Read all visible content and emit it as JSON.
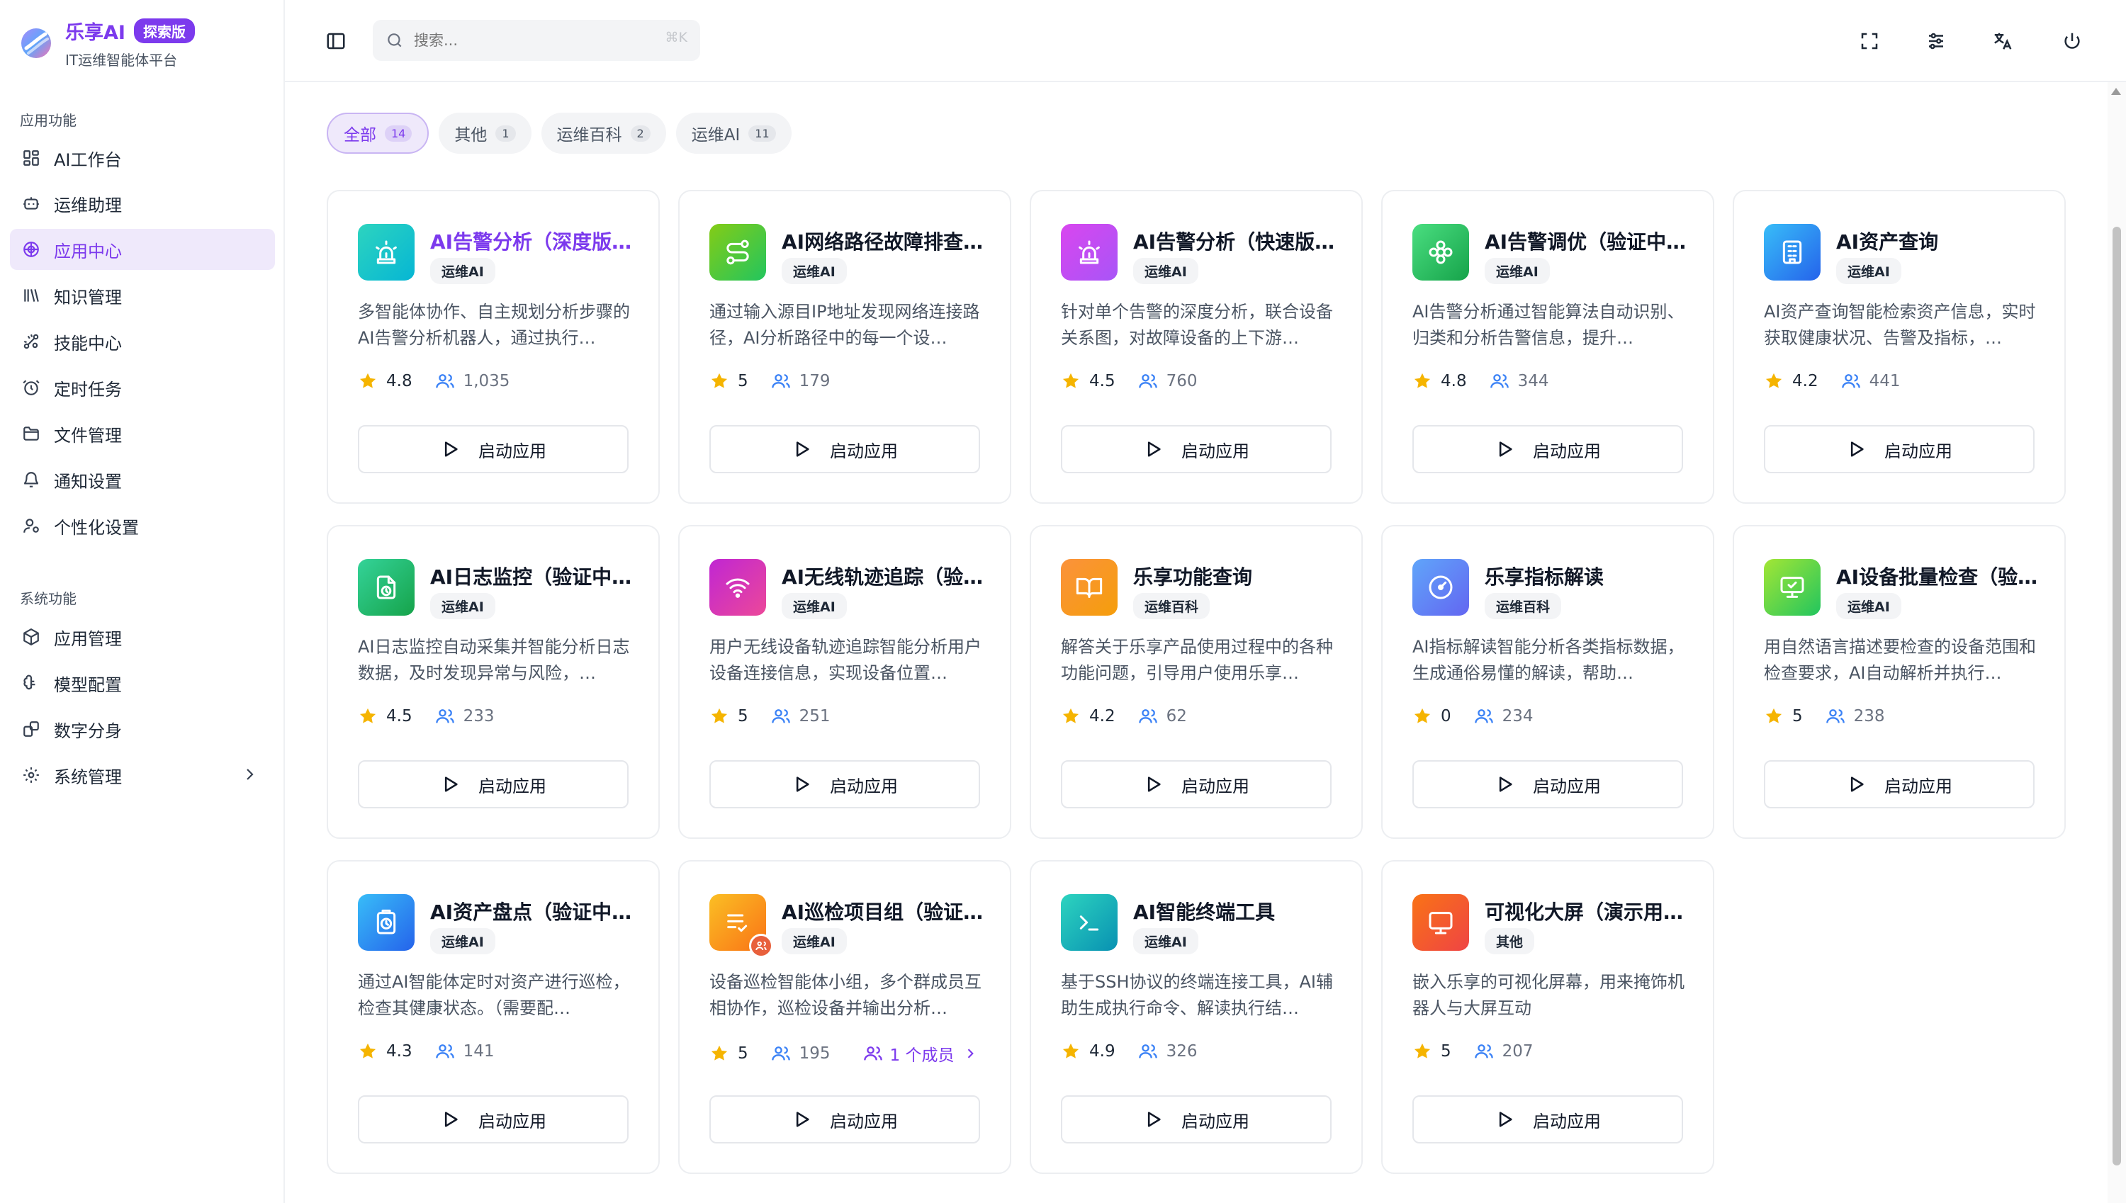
{
  "brand": {
    "name": "乐享AI",
    "badge": "探索版",
    "subtitle": "IT运维智能体平台"
  },
  "sidebar": {
    "group_app": "应用功能",
    "group_sys": "系统功能",
    "items": [
      {
        "label": "AI工作台",
        "icon": "dashboard-icon"
      },
      {
        "label": "运维助理",
        "icon": "bot-icon"
      },
      {
        "label": "应用中心",
        "icon": "app-center-icon",
        "active": true
      },
      {
        "label": "知识管理",
        "icon": "library-icon"
      },
      {
        "label": "技能中心",
        "icon": "skill-icon"
      },
      {
        "label": "定时任务",
        "icon": "alarm-clock-icon"
      },
      {
        "label": "文件管理",
        "icon": "folder-icon"
      },
      {
        "label": "通知设置",
        "icon": "bell-icon"
      },
      {
        "label": "个性化设置",
        "icon": "user-settings-icon"
      },
      {
        "label": "应用管理",
        "icon": "package-icon"
      },
      {
        "label": "模型配置",
        "icon": "brain-icon"
      },
      {
        "label": "数字分身",
        "icon": "avatar-link-icon"
      },
      {
        "label": "系统管理",
        "icon": "gear-icon"
      }
    ]
  },
  "search": {
    "placeholder": "搜索...",
    "shortcut": "⌘K"
  },
  "filters": [
    {
      "label": "全部",
      "count": "14",
      "active": true
    },
    {
      "label": "其他",
      "count": "1"
    },
    {
      "label": "运维百科",
      "count": "2"
    },
    {
      "label": "运维AI",
      "count": "11"
    }
  ],
  "launch_label": "启动应用",
  "colors": {
    "accent": "#7c3aed",
    "star": "#f5b400",
    "users": "#3b82f6"
  },
  "cards": [
    {
      "title": "AI告警分析（深度版…",
      "tag": "运维AI",
      "desc": "多智能体协作、自主规划分析步骤的AI告警分析机器人，通过执行…",
      "rating": "4.8",
      "users": "1,035",
      "icon": "alarm-siren-icon",
      "bg": "linear-gradient(135deg,#2dd4bf,#06b6d4)",
      "purple": true
    },
    {
      "title": "AI网络路径故障排查…",
      "tag": "运维AI",
      "desc": "通过输入源目IP地址发现网络连接路径，AI分析路径中的每一个设…",
      "rating": "5",
      "users": "179",
      "icon": "route-icon",
      "bg": "linear-gradient(135deg,#84cc16,#22c55e)"
    },
    {
      "title": "AI告警分析（快速版…",
      "tag": "运维AI",
      "desc": "针对单个告警的深度分析，联合设备关系图，对故障设备的上下游…",
      "rating": "4.5",
      "users": "760",
      "icon": "alarm-siren-icon",
      "bg": "linear-gradient(135deg,#d946ef,#a855f7)"
    },
    {
      "title": "AI告警调优（验证中…",
      "tag": "运维AI",
      "desc": "AI告警分析通过智能算法自动识别、归类和分析告警信息，提升…",
      "rating": "4.8",
      "users": "344",
      "icon": "flower-icon",
      "bg": "linear-gradient(135deg,#4ade80,#16a34a)"
    },
    {
      "title": "AI资产查询",
      "tag": "运维AI",
      "desc": "AI资产查询智能检索资产信息，实时获取健康状况、告警及指标，…",
      "rating": "4.2",
      "users": "441",
      "icon": "building-icon",
      "bg": "linear-gradient(135deg,#38bdf8,#2563eb)"
    },
    {
      "title": "AI日志监控（验证中…",
      "tag": "运维AI",
      "desc": "AI日志监控自动采集并智能分析日志数据，及时发现异常与风险，…",
      "rating": "4.5",
      "users": "233",
      "icon": "file-clock-icon",
      "bg": "linear-gradient(135deg,#34d399,#16a34a)"
    },
    {
      "title": "AI无线轨迹追踪（验…",
      "tag": "运维AI",
      "desc": "用户无线设备轨迹追踪智能分析用户设备连接信息，实现设备位置…",
      "rating": "5",
      "users": "251",
      "icon": "wifi-icon",
      "bg": "linear-gradient(135deg,#c026d3,#ec4899)"
    },
    {
      "title": "乐享功能查询",
      "tag": "运维百科",
      "desc": "解答关于乐享产品使用过程中的各种功能问题，引导用户使用乐享…",
      "rating": "4.2",
      "users": "62",
      "icon": "book-open-icon",
      "bg": "linear-gradient(135deg,#fb923c,#f59e0b)"
    },
    {
      "title": "乐享指标解读",
      "tag": "运维百科",
      "desc": "AI指标解读智能分析各类指标数据，生成通俗易懂的解读，帮助…",
      "rating": "0",
      "users": "234",
      "icon": "gauge-icon",
      "bg": "linear-gradient(135deg,#60a5fa,#6366f1)"
    },
    {
      "title": "AI设备批量检查（验…",
      "tag": "运维AI",
      "desc": "用自然语言描述要检查的设备范围和检查要求，AI自动解析并执行…",
      "rating": "5",
      "users": "238",
      "icon": "monitor-check-icon",
      "bg": "linear-gradient(135deg,#a3e635,#22c55e)"
    },
    {
      "title": "AI资产盘点（验证中…",
      "tag": "运维AI",
      "desc": "通过AI智能体定时对资产进行巡检，检查其健康状态。（需要配…",
      "rating": "4.3",
      "users": "141",
      "icon": "clipboard-clock-icon",
      "bg": "linear-gradient(135deg,#38bdf8,#2563eb)"
    },
    {
      "title": "AI巡检项目组（验证…",
      "tag": "运维AI",
      "desc": "设备巡检智能体小组，多个群成员互相协作，巡检设备并输出分析…",
      "rating": "5",
      "users": "195",
      "icon": "list-check-icon",
      "bg": "linear-gradient(135deg,#fbbf24,#f97316)",
      "members": "1 个成员",
      "group_badge": "group-badge-icon"
    },
    {
      "title": "AI智能终端工具",
      "tag": "运维AI",
      "desc": "基于SSH协议的终端连接工具，AI辅助生成执行命令、解读执行结…",
      "rating": "4.9",
      "users": "326",
      "icon": "terminal-icon",
      "bg": "linear-gradient(135deg,#2dd4bf,#0891b2)"
    },
    {
      "title": "可视化大屏（演示用…",
      "tag": "其他",
      "desc": "嵌入乐享的可视化屏幕，用来掩饰机器人与大屏互动",
      "rating": "5",
      "users": "207",
      "icon": "screen-icon",
      "bg": "linear-gradient(135deg,#f97316,#ef4444)"
    }
  ]
}
